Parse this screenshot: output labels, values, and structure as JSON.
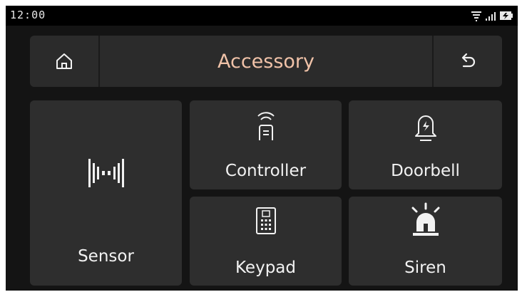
{
  "status_bar": {
    "time": "12:00",
    "icons": [
      "wifi-icon",
      "signal-icon",
      "battery-charging-icon"
    ]
  },
  "header": {
    "title": "Accessory",
    "home_icon": "home-icon",
    "back_icon": "back-arrow-icon"
  },
  "tiles": {
    "sensor": {
      "label": "Sensor",
      "icon": "sensor-icon"
    },
    "controller": {
      "label": "Controller",
      "icon": "remote-controller-icon"
    },
    "doorbell": {
      "label": "Doorbell",
      "icon": "doorbell-icon"
    },
    "keypad": {
      "label": "Keypad",
      "icon": "keypad-icon"
    },
    "siren": {
      "label": "Siren",
      "icon": "siren-icon"
    }
  },
  "colors": {
    "background": "#141414",
    "tile": "#2e2e2e",
    "title_accent": "#f0c2a8",
    "text": "#f2f2f2"
  }
}
